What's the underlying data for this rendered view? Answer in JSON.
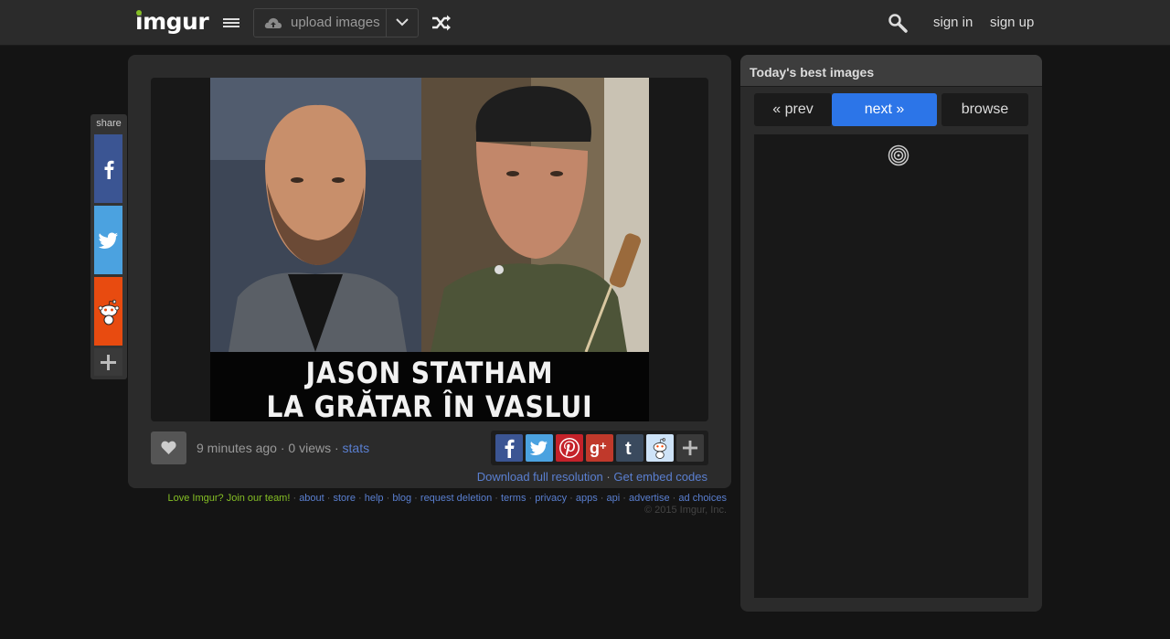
{
  "header": {
    "logo_text": "imgur",
    "upload_label": "upload images",
    "sign_in": "sign in",
    "sign_up": "sign up",
    "icons": [
      "menu-icon",
      "cloud-upload-icon",
      "chevron-down-icon",
      "shuffle-icon",
      "search-icon"
    ]
  },
  "share_rail": {
    "title": "share",
    "items": [
      "facebook-icon",
      "twitter-icon",
      "reddit-icon",
      "plus-icon"
    ]
  },
  "image": {
    "caption_line1": "JASON STATHAM",
    "caption_line2": "LA GRĂTAR ÎN VASLUI",
    "time": "9 minutes ago",
    "views": "0 views",
    "stats": "stats",
    "separator": "·",
    "download_label": "Download full resolution",
    "embed_label": "Get embed codes"
  },
  "social_buttons": [
    "facebook",
    "twitter",
    "pinterest",
    "google-plus",
    "tumblr",
    "reddit",
    "more"
  ],
  "footer": {
    "join": "Love Imgur? Join our team!",
    "links": [
      "about",
      "store",
      "help",
      "blog",
      "request deletion",
      "terms",
      "privacy",
      "apps",
      "api",
      "advertise",
      "ad choices"
    ],
    "copyright": "© 2015 Imgur, Inc."
  },
  "sidebar": {
    "title": "Today's best images",
    "prev": "« prev",
    "next": "next »",
    "browse": "browse"
  },
  "colors": {
    "accent": "#2c75e8",
    "brand_green": "#85bf25",
    "link": "#5a7fd0",
    "background": "#141414",
    "panel": "#2b2b2b"
  }
}
